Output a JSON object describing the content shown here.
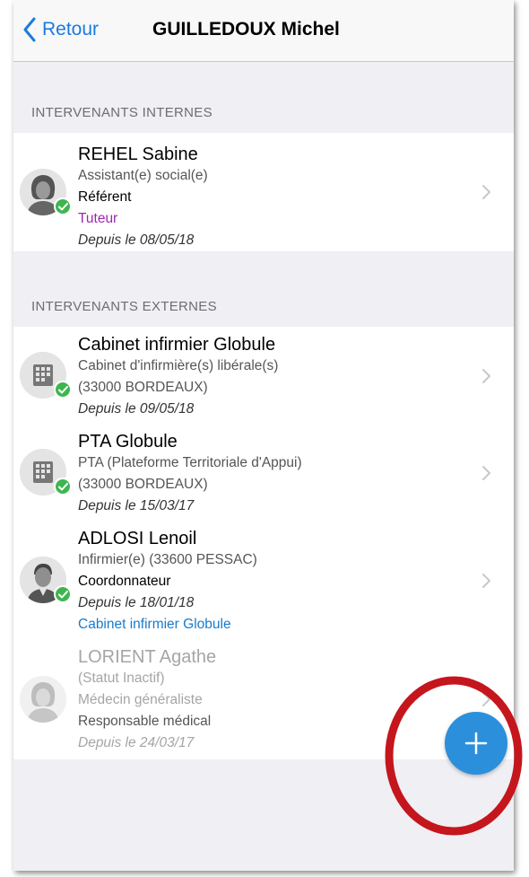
{
  "navbar": {
    "back_label": "Retour",
    "title": "GUILLEDOUX Michel"
  },
  "internal": {
    "header": "INTERVENANTS INTERNES",
    "items": [
      {
        "name": "REHEL Sabine",
        "function": "Assistant(e) social(e)",
        "role": "Référent",
        "tag": "Tuteur",
        "since": "Depuis le 08/05/18",
        "avatar": "person-female-icon",
        "active": true
      }
    ]
  },
  "external": {
    "header": "INTERVENANTS EXTERNES",
    "items": [
      {
        "name": "Cabinet infirmier Globule",
        "function": "Cabinet d'infirmière(s) libérale(s)",
        "location": "(33000 BORDEAUX)",
        "since": "Depuis le 09/05/18",
        "avatar": "building-icon",
        "active": true
      },
      {
        "name": "PTA Globule",
        "function": "PTA (Plateforme Territoriale d'Appui)",
        "location": "(33000 BORDEAUX)",
        "since": "Depuis le 15/03/17",
        "avatar": "building-icon",
        "active": true
      },
      {
        "name": "ADLOSI Lenoil",
        "function": "Infirmier(e) (33600 PESSAC)",
        "role": "Coordonnateur",
        "since": "Depuis le 18/01/18",
        "link": "Cabinet infirmier Globule",
        "avatar": "person-male-icon",
        "active": true
      },
      {
        "name": "LORIENT Agathe",
        "status": "(Statut Inactif)",
        "function": "Médecin généraliste",
        "role": "Responsable médical",
        "since": "Depuis le 24/03/17",
        "avatar": "person-female-icon",
        "active": false
      }
    ]
  },
  "fab": {
    "icon": "plus-icon"
  },
  "colors": {
    "accent": "#1a7be0",
    "check": "#3fb550",
    "tutor": "#9b27b0",
    "fab": "#2b8fdc",
    "highlight_ring": "#c4161c"
  }
}
